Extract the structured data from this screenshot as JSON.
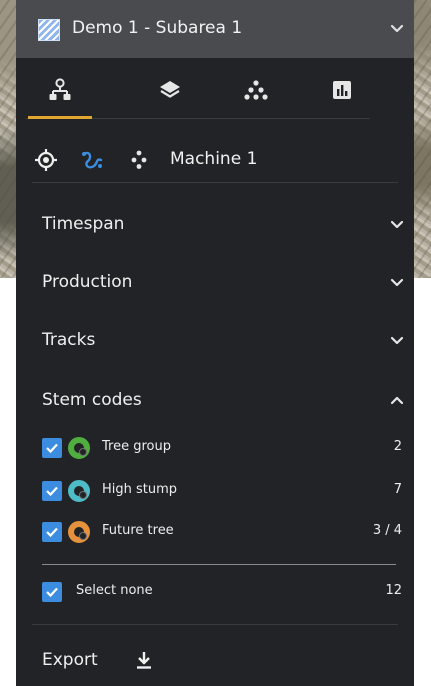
{
  "header": {
    "title": "Demo 1 - Subarea 1"
  },
  "tabs": [
    {
      "icon": "machines-icon",
      "active": true
    },
    {
      "icon": "layers-icon",
      "active": false
    },
    {
      "icon": "stem-points-icon",
      "active": false
    },
    {
      "icon": "report-chart-icon",
      "active": false
    }
  ],
  "toolbar": {
    "machine_label": "Machine 1"
  },
  "sections": {
    "timespan": "Timespan",
    "production": "Production",
    "tracks": "Tracks",
    "stem_codes": "Stem codes"
  },
  "stem_codes": [
    {
      "label": "Tree group",
      "count": "2",
      "color": "#4fae3e",
      "checked": true
    },
    {
      "label": "High stump",
      "count": "7",
      "color": "#4dbcc7",
      "checked": true
    },
    {
      "label": "Future tree",
      "count": "3 / 4",
      "color": "#e6923d",
      "checked": true
    }
  ],
  "select_none": {
    "label": "Select none",
    "count": "12",
    "checked": true
  },
  "export": {
    "label": "Export"
  },
  "colors": {
    "accent": "#e3a531",
    "checkbox": "#3c8de0",
    "panel": "#222326",
    "header": "#4a4b4f"
  }
}
